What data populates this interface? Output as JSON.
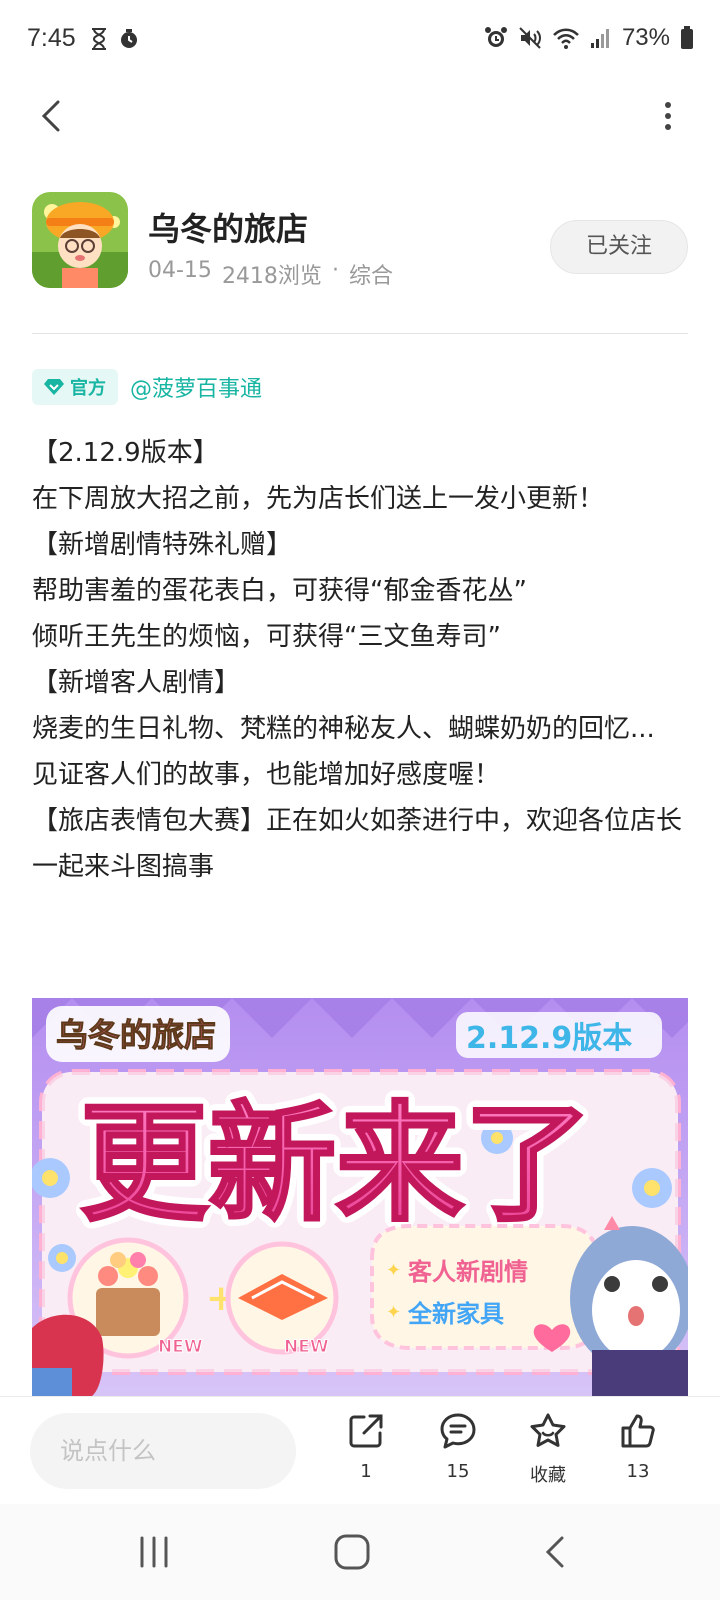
{
  "status": {
    "time": "7:45",
    "battery": "73%"
  },
  "author": {
    "name": "乌冬的旅店",
    "date": "04-15",
    "views": "2418浏览",
    "separator": "·",
    "category": "综合",
    "follow_label": "已关注"
  },
  "tag": {
    "official_label": "官方",
    "mention": "@菠萝百事通"
  },
  "post": {
    "lines": [
      "【2.12.9版本】",
      "在下周放大招之前，先为店长们送上一发小更新！",
      "【新增剧情特殊礼赠】",
      "帮助害羞的蛋花表白，可获得“郁金香花丛”",
      "倾听王先生的烦恼，可获得“三文鱼寿司”",
      "【新增客人剧情】",
      "烧麦的生日礼物、梵糕的神秘友人、蝴蝶奶奶的回忆...",
      "见证客人们的故事，也能增加好感度喔！",
      "【旅店表情包大赛】正在如火如荼进行中，欢迎各位店长一起来斗图搞事"
    ]
  },
  "banner": {
    "logo_text": "乌冬的旅店",
    "version_text": "2.12.9版本",
    "headline": "更新来了",
    "feature_1": "客人新剧情",
    "feature_2": "全新家具",
    "new_badge": "NEW"
  },
  "actions": {
    "comment_placeholder": "说点什么",
    "share_count": "1",
    "comment_count": "15",
    "collect_label": "收藏",
    "like_count": "13"
  },
  "colors": {
    "accent": "#19b5a3",
    "banner_pink": "#f05aa8",
    "banner_purple": "#a47ce6"
  }
}
